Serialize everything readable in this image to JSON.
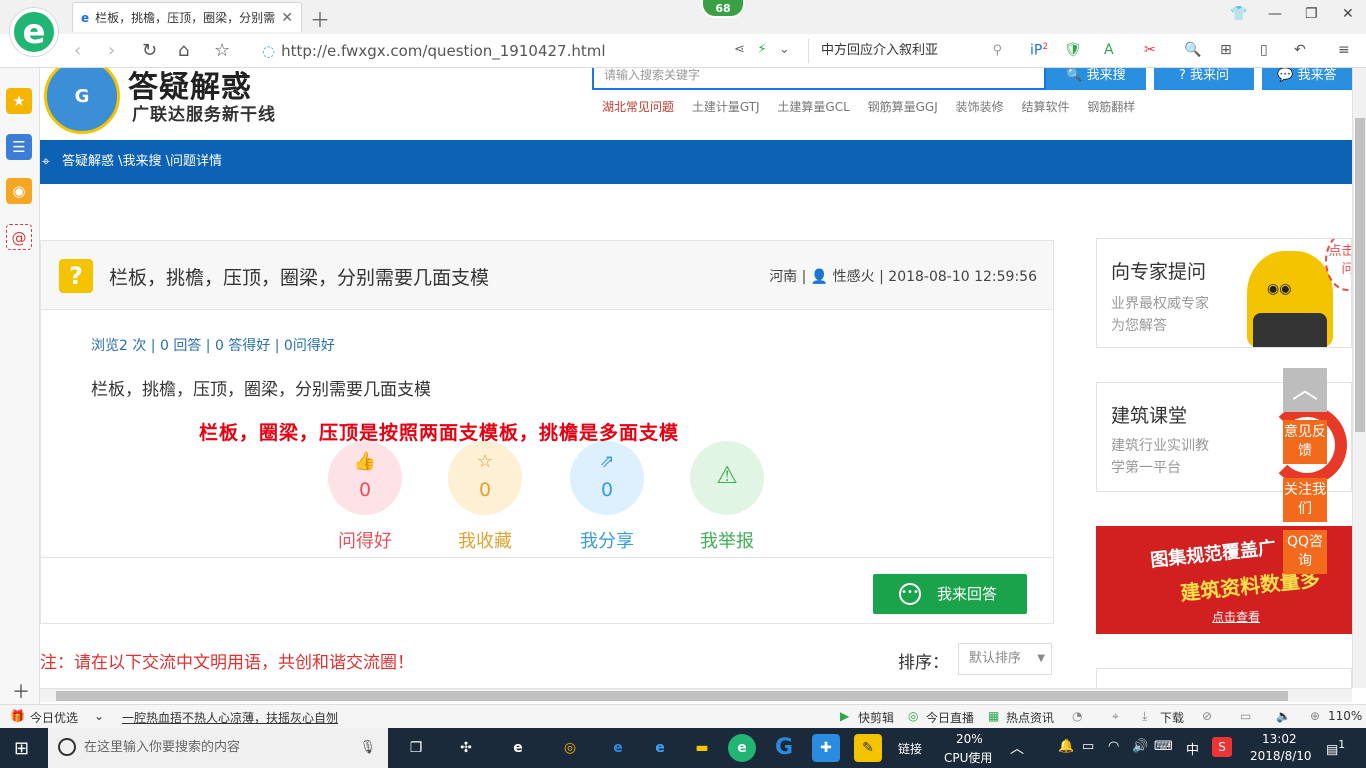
{
  "browser": {
    "tab_title": "栏板，挑檐，压顶，圈梁，分别需",
    "badge_count": "68",
    "url": "http://e.fwxgx.com/question_1910427.html",
    "search_text": "中方回应介入叙利亚",
    "ext_badge": "2"
  },
  "site": {
    "logo_title": "答疑解惑",
    "logo_subtitle": "广联达服务新干线",
    "search_placeholder": "请输入搜索关键字",
    "btn_search": "我来搜",
    "btn_ask": "我来问",
    "btn_answer": "我来答",
    "hot_links": [
      "湖北常见问题",
      "土建计量GTJ",
      "土建算量GCL",
      "钢筋算量GGJ",
      "装饰装修",
      "结算软件",
      "钢筋翻样"
    ],
    "breadcrumb": "答疑解惑 \\我来搜 \\问题详情"
  },
  "question": {
    "title": "栏板，挑檐，压顶，圈梁，分别需要几面支模",
    "meta": "河南 | 👤 性感火 | 2018-08-10 12:59:56",
    "stats": "浏览2 次 | 0 回答 | 0 答得好 | 0问得好",
    "body": "栏板，挑檐，压顶，圈梁，分别需要几面支模",
    "answer_overlay": "栏板，圈梁，压顶是按照两面支模板，挑檐是多面支模",
    "actions": [
      {
        "label": "问得好",
        "count": "0"
      },
      {
        "label": "我收藏",
        "count": "0"
      },
      {
        "label": "我分享",
        "count": "0"
      },
      {
        "label": "我举报",
        "count": ""
      }
    ],
    "answer_button": "我来回答"
  },
  "comments": {
    "notice": "注：请在以下交流中文明用语，共创和谐交流圈！",
    "sort_label": "排序：",
    "sort_value": "默认排序"
  },
  "sidebar_right": {
    "expert_title": "向专家提问",
    "expert_sub1": "业界最权威专家",
    "expert_sub2": "为您解答",
    "click_tip": "点击提问",
    "course_title": "建筑课堂",
    "course_sub1": "建筑行业实训教",
    "course_sub2": "学第一平台",
    "ad_line1": "图集规范覆盖广",
    "ad_line2": "建筑资料数量多",
    "ad_line3": "点击查看",
    "float_feedback": "意见反馈",
    "float_follow": "关注我们",
    "float_qq": "QQ咨询"
  },
  "statusbar": {
    "today": "今日优选",
    "headline": "一腔热血捂不热人心凉薄，扶摇灰心自刎",
    "items": [
      "快剪辑",
      "今日直播",
      "热点资讯",
      "下载"
    ],
    "zoom": "110%"
  },
  "taskbar": {
    "search_placeholder": "在这里输入你要搜索的内容",
    "link_label": "链接",
    "cpu_percent": "20%",
    "cpu_label": "CPU使用",
    "ime": "中",
    "time": "13:02",
    "date": "2018/8/10",
    "notif_count": "1"
  },
  "colors": {
    "brand_blue": "#0d62b5",
    "answer_red": "#e60012",
    "answer_green": "#1aa34a",
    "float_orange": "#f26b1d"
  }
}
